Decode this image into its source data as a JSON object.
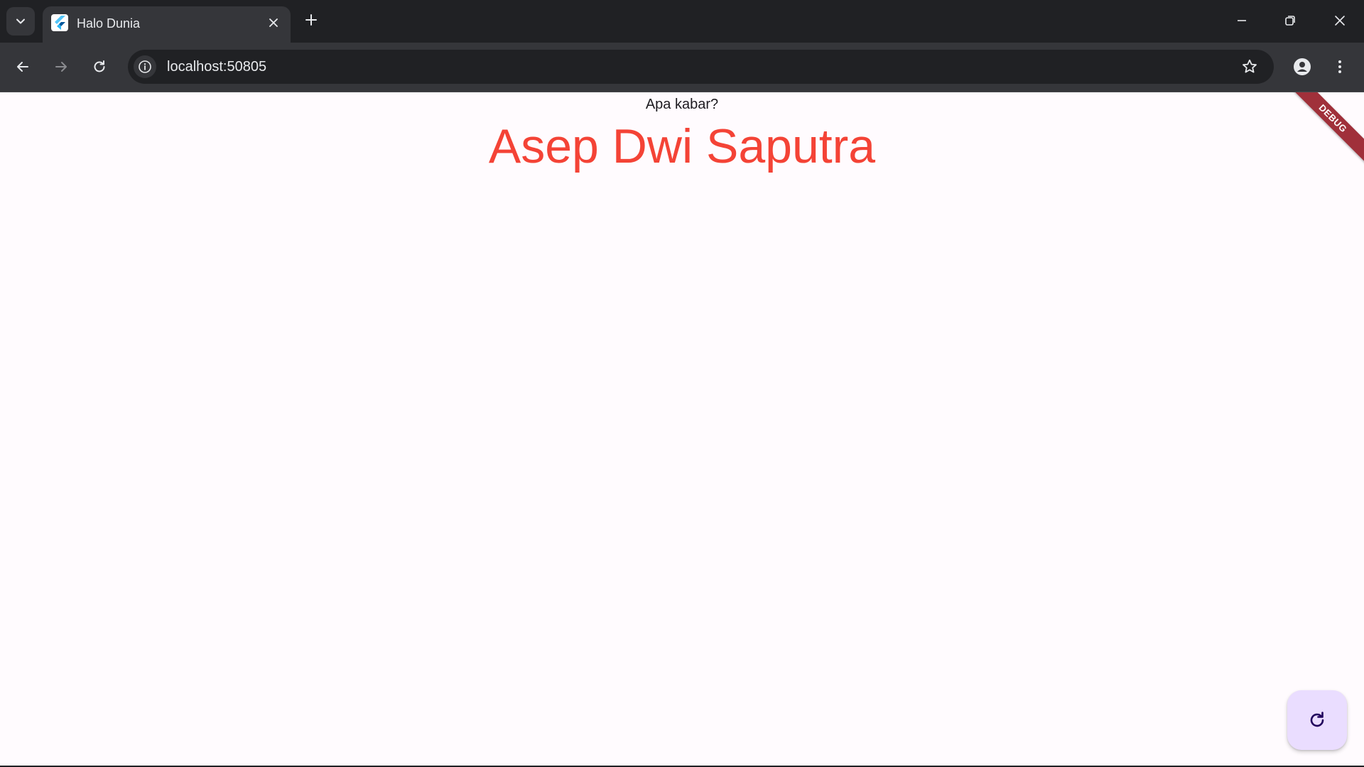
{
  "browser": {
    "tab": {
      "title": "Halo Dunia",
      "favicon": "flutter-logo-icon"
    },
    "address_bar": {
      "url": "localhost:50805"
    },
    "icons": {
      "tab_search": "chevron-down-icon",
      "tab_close": "close-icon",
      "new_tab": "plus-icon",
      "minimize": "minimize-icon",
      "restore": "restore-icon",
      "close_window": "close-icon",
      "back": "arrow-left-icon",
      "forward": "arrow-right-icon",
      "reload": "reload-icon",
      "site_info": "info-icon",
      "bookmark": "star-icon",
      "profile": "person-icon",
      "menu": "more-vert-icon"
    },
    "colors": {
      "frame": "#202124",
      "toolbar": "#35363a",
      "text": "#e8eaed"
    }
  },
  "app": {
    "greeting": "Apa kabar?",
    "name": "Asep Dwi Saputra",
    "debug_banner": "DEBUG",
    "fab_icon": "refresh-icon",
    "colors": {
      "background": "#fffbfe",
      "name_text": "#f44336",
      "fab_background": "#eaddff",
      "fab_icon": "#21005d",
      "debug_banner": "#a0303a"
    }
  }
}
